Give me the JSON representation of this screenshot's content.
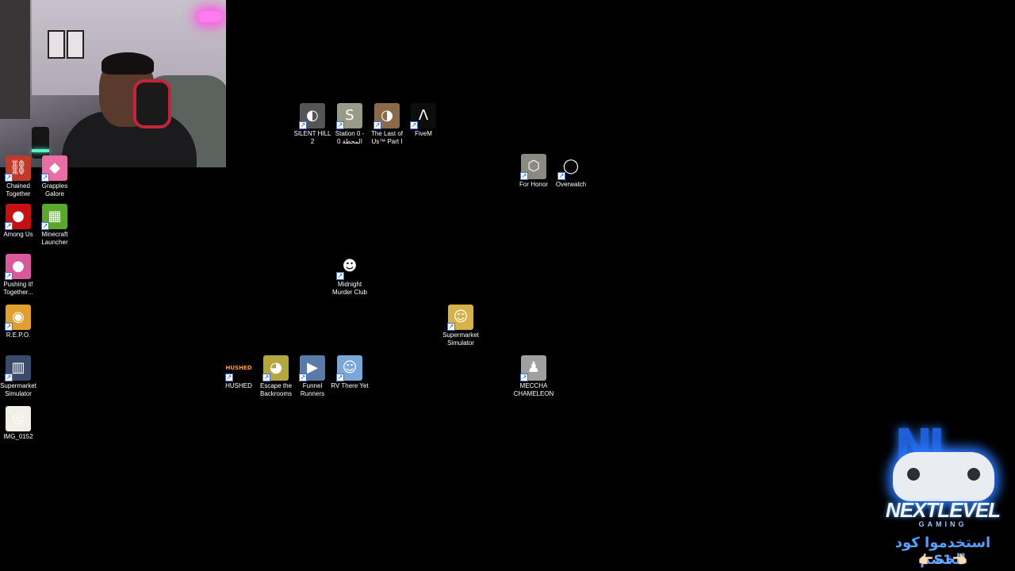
{
  "webcam": {
    "description_hidden": ""
  },
  "desktop_icons": [
    {
      "id": "chained-together",
      "label": "Chained\nTogether",
      "bg": "#c0392b",
      "glyph": "⛓",
      "shortcut": true
    },
    {
      "id": "grapples-galore",
      "label": "Grapples\nGalore",
      "bg": "#e86fa5",
      "glyph": "◆",
      "shortcut": true
    },
    {
      "id": "among-us",
      "label": "Among Us",
      "bg": "#c51111",
      "glyph": "●",
      "shortcut": true
    },
    {
      "id": "minecraft-launcher",
      "label": "Minecraft\nLauncher",
      "bg": "#5aa82e",
      "glyph": "▦",
      "shortcut": true
    },
    {
      "id": "pushing-it-together",
      "label": "Pushing it!\nTogether...",
      "bg": "#d95a9c",
      "glyph": "●",
      "shortcut": true
    },
    {
      "id": "repo",
      "label": "R.E.P.O.",
      "bg": "#e0a030",
      "glyph": "◉",
      "shortcut": true
    },
    {
      "id": "supermarket-simulator-left",
      "label": "Supermarket\nSimulator",
      "bg": "#3a4a6a",
      "glyph": "▥",
      "shortcut": true
    },
    {
      "id": "img-0152",
      "label": "IMG_0152",
      "bg": "#f2efe8",
      "glyph": "◎",
      "shortcut": false
    },
    {
      "id": "silent-hill-2",
      "label": "SILENT HILL\n2",
      "bg": "#555555",
      "glyph": "◐",
      "shortcut": true
    },
    {
      "id": "station-0",
      "label": "Station 0 -\nالمحطة 0",
      "bg": "#9a9a8a",
      "glyph": "S",
      "shortcut": true
    },
    {
      "id": "last-of-us",
      "label": "The Last of\nUs™ Part I",
      "bg": "#8a6a48",
      "glyph": "◑",
      "shortcut": true
    },
    {
      "id": "fivem",
      "label": "FiveM",
      "bg": "#0d0d0d",
      "glyph": "Λ",
      "shortcut": true
    },
    {
      "id": "for-honor",
      "label": "For Honor",
      "bg": "#8a8a80",
      "glyph": "⬡",
      "shortcut": true
    },
    {
      "id": "overwatch",
      "label": "Overwatch",
      "bg": "#000000",
      "glyph": "◯",
      "shortcut": true
    },
    {
      "id": "midnight-murder-club",
      "label": "Midnight\nMurder Club",
      "bg": "#000000",
      "glyph": "☻",
      "shortcut": true
    },
    {
      "id": "supermarket-simulator-mid",
      "label": "Supermarket\nSimulator",
      "bg": "#d7b24a",
      "glyph": "☺",
      "shortcut": true
    },
    {
      "id": "hushed",
      "label": "HUSHED",
      "bg": "#000000",
      "glyph": "HUSHED",
      "shortcut": true
    },
    {
      "id": "escape-the-backrooms",
      "label": "Escape the\nBackrooms",
      "bg": "#b4a640",
      "glyph": "◕",
      "shortcut": true
    },
    {
      "id": "funnel-runners",
      "label": "Funnel\nRunners",
      "bg": "#5a7aa8",
      "glyph": "▶",
      "shortcut": true
    },
    {
      "id": "rv-there-yet",
      "label": "RV There Yet",
      "bg": "#7aa6d8",
      "glyph": "☺",
      "shortcut": true
    },
    {
      "id": "meccha-chameleon",
      "label": "MECCHA\nCHAMELEON",
      "bg": "#a0a0a0",
      "glyph": "♟",
      "shortcut": true
    }
  ],
  "overlay": {
    "logo_line1": "NEXTLEVEL",
    "logo_line2": "GAMING",
    "promo_text": "استخدموا كود الخصم",
    "promo_code": "👉🏻S1👈🏻"
  }
}
